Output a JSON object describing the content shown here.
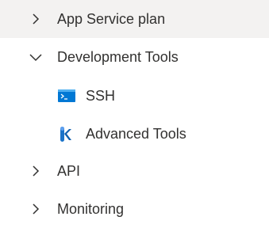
{
  "nav": {
    "items": [
      {
        "label": "App Service plan",
        "expanded": false,
        "icon": "chevron-right-icon"
      },
      {
        "label": "Development Tools",
        "expanded": true,
        "icon": "chevron-down-icon",
        "children": [
          {
            "label": "SSH",
            "icon": "ssh-console-icon"
          },
          {
            "label": "Advanced Tools",
            "icon": "advanced-tools-icon"
          }
        ]
      },
      {
        "label": "API",
        "expanded": false,
        "icon": "chevron-right-icon"
      },
      {
        "label": "Monitoring",
        "expanded": false,
        "icon": "chevron-right-icon"
      }
    ]
  },
  "colors": {
    "selected_background": "#f3f2f1",
    "text": "#323130",
    "ssh_icon": "#0078d4",
    "advanced_tools_icon": "#1a73c9"
  }
}
